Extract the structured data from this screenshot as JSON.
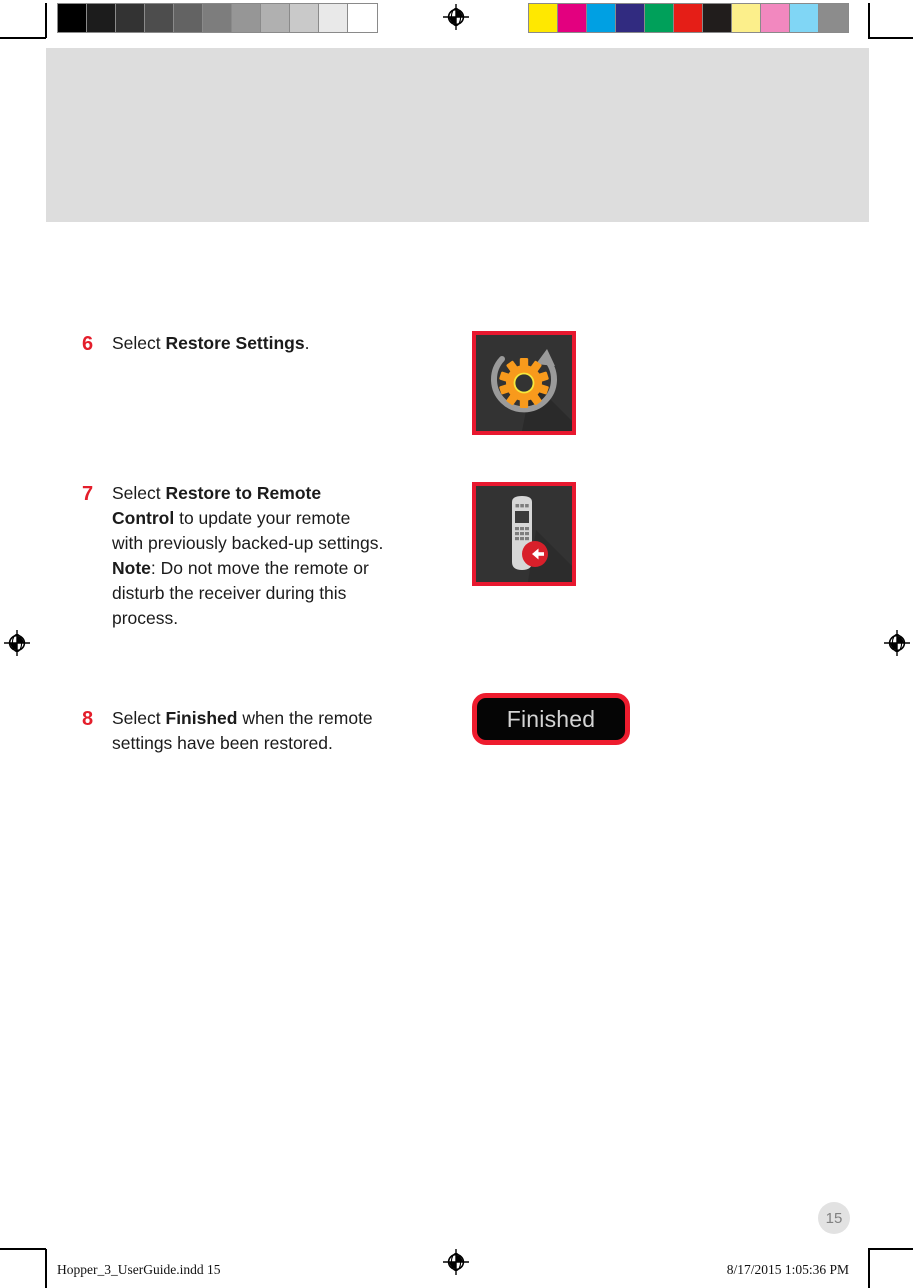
{
  "document": {
    "page_number": "15",
    "footer": {
      "file_name": "Hopper_3_UserGuide.indd   15",
      "timestamp": "8/17/2015   1:05:36 PM"
    }
  },
  "calibration": {
    "gray_ramp": [
      "#000000",
      "#1c1c1c",
      "#333333",
      "#4d4d4d",
      "#636363",
      "#7d7d7d",
      "#969696",
      "#b0b0b0",
      "#c9c9c9",
      "#e9e9e9",
      "#ffffff"
    ],
    "color_ramp": [
      "#ffe800",
      "#e3007f",
      "#00a0e3",
      "#312b80",
      "#00a05a",
      "#e51e17",
      "#211d1c",
      "#fcef8b",
      "#f288bf",
      "#80d6f5",
      "#8c8c8c"
    ],
    "registration_icon": "registration-target-icon"
  },
  "steps": [
    {
      "number": "6",
      "segments": [
        {
          "text": "Select ",
          "bold": false
        },
        {
          "text": "Restore Settings",
          "bold": true
        },
        {
          "text": ".",
          "bold": false
        }
      ],
      "graphic": {
        "name": "restore-settings-icon",
        "type": "icon-tile",
        "border_color": "#e8182f",
        "background_color": "#333333",
        "gear_color": "#f89a1c",
        "ring_color": "#f5e83c",
        "arrow_color": "#9a9a9a"
      }
    },
    {
      "number": "7",
      "segments": [
        {
          "text": "Select ",
          "bold": false
        },
        {
          "text": "Restore to Remote Control",
          "bold": true
        },
        {
          "text": " to update your remote with previously backed-up settings.\n",
          "bold": false
        },
        {
          "text": "Note",
          "bold": true
        },
        {
          "text": ":  Do not move the remote or disturb the receiver during this process.",
          "bold": false
        }
      ],
      "graphic": {
        "name": "restore-to-remote-control-icon",
        "type": "icon-tile",
        "border_color": "#e8182f",
        "background_color": "#333333",
        "remote_color": "#d7d7d7",
        "screen_color": "#3a3a3a",
        "badge_color": "#d81f2a",
        "badge_arrow_color": "#ffffff"
      }
    },
    {
      "number": "8",
      "segments": [
        {
          "text": "Select ",
          "bold": false
        },
        {
          "text": "Finished",
          "bold": true
        },
        {
          "text": " when the remote settings have been restored.",
          "bold": false
        }
      ],
      "graphic": {
        "name": "finished-button",
        "type": "button",
        "label": "Finished",
        "border_color": "#ee1c2e",
        "background_color": "#050505",
        "text_color": "#d4d4d4"
      }
    }
  ],
  "colors": {
    "step_number": "#e41e2b",
    "body_text": "#1b1b1b",
    "banner": "#dddddd",
    "page_badge_bg": "#e2e2e2",
    "page_badge_text": "#808080"
  }
}
